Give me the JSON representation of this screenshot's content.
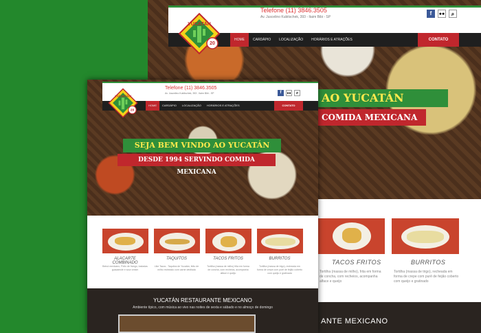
{
  "site": {
    "phone": "Telefone (11) 3846.3505",
    "address": "Av. Juscelino Kubitschek, 393 - Itaim Bibi - SP",
    "logo_text": "YUCATÁN",
    "logo_badge": "20",
    "logo_badge_sub": "anos",
    "nav": [
      "HOME",
      "CARDÁPIO",
      "LOCALIZAÇÃO",
      "HORÁRIOS E ATRAÇÕES"
    ],
    "contact": "CONTATO",
    "social": {
      "facebook": "f",
      "tripadvisor": "tripadvisor-icon",
      "search": "search-icon"
    }
  },
  "hero": {
    "banner_front_1": "SEJA BEM VINDO AO YUCATÁN",
    "banner_front_2": "DESDE 1994 SERVINDO COMIDA MEXICANA",
    "banner_back_1": "AO YUCATÁN",
    "banner_back_2": "COMIDA MEXICANA"
  },
  "front_cards": [
    {
      "title": "ALACARTE COMBINADO",
      "desc": "Beirut mexicano, Pollo de frango, tostadas guacamole e sour cream"
    },
    {
      "title": "TAQUITOS",
      "desc": "Like Tacos - Taquitos de Yucatán, feito de milho recheado com carne desfiada"
    },
    {
      "title": "TACOS FRITOS",
      "desc": "Tortilha (massa de milho) frita em forma de concha, com recheios, acompanha alface e queijo"
    },
    {
      "title": "BURRITOS",
      "desc": "Tortilha (massa de trigo), recheada em forma de crepe com purê de feijão coberto com queijo e gratinada"
    }
  ],
  "back_cards": [
    {
      "title": "TACOS FRITOS",
      "desc": "Tortilha (massa de milho), frita em forma de concha, com recheios, acompanha alface e queijo"
    },
    {
      "title": "BURRITOS",
      "desc": "Tortilha (massa de trigo), recheada em forma de crepe com purê de feijão coberto com queijo e gratinado"
    }
  ],
  "about": {
    "title_front": "YUCATÁN RESTAURANTE MEXICANO",
    "subtitle_front": "Ambiente típico, com música ao vivo nas noites de sexta e sábado e no almoço de domingo",
    "title_back": "ANTE MEXICANO"
  },
  "colors": {
    "green": "#2f8f3a",
    "red": "#c0272d",
    "yellow": "#ffe94d",
    "page_bg": "#23882c"
  }
}
